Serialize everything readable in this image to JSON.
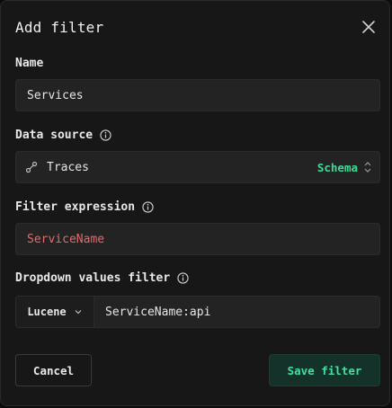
{
  "dialog": {
    "title": "Add filter",
    "close_icon": "close-icon"
  },
  "name_section": {
    "label": "Name",
    "value": "Services"
  },
  "data_source": {
    "label": "Data source",
    "info_icon": "info-icon",
    "source_icon": "link-icon",
    "value": "Traces",
    "schema_label": "Schema",
    "selector_icon": "up-down-chevron-icon"
  },
  "filter_expression": {
    "label": "Filter expression",
    "info_icon": "info-icon",
    "value": "ServiceName",
    "value_color": "#e66a6a"
  },
  "dropdown_filter": {
    "label": "Dropdown values filter",
    "info_icon": "info-icon",
    "syntax_option": "Lucene",
    "value": "ServiceName:api"
  },
  "actions": {
    "cancel_label": "Cancel",
    "save_label": "Save filter"
  },
  "colors": {
    "accent": "#3ddc97",
    "dialog_bg": "#171717",
    "field_bg": "#232323"
  }
}
